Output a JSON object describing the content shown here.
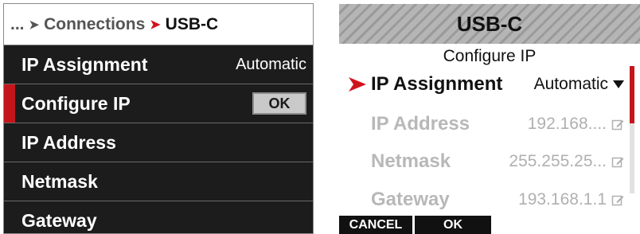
{
  "left_panel": {
    "breadcrumb": {
      "ellipsis": "...",
      "parent": "Connections",
      "current": "USB-C"
    },
    "rows": [
      {
        "label": "IP Assignment",
        "value": "Automatic"
      },
      {
        "label": "Configure IP",
        "button": "OK",
        "selected": true
      },
      {
        "label": "IP Address"
      },
      {
        "label": "Netmask"
      },
      {
        "label": "Gateway"
      }
    ]
  },
  "right_panel": {
    "title": "USB-C",
    "subtitle": "Configure IP",
    "rows": [
      {
        "label": "IP Assignment",
        "value": "Automatic",
        "icon": "chevron-down-icon",
        "state": "active"
      },
      {
        "label": "IP Address",
        "value": "192.168....",
        "icon": "edit-icon",
        "state": "disabled"
      },
      {
        "label": "Netmask",
        "value": "255.255.25...",
        "icon": "edit-icon",
        "state": "disabled"
      },
      {
        "label": "Gateway",
        "value": "193.168.1.1",
        "icon": "edit-icon",
        "state": "disabled"
      }
    ],
    "softkeys": {
      "cancel": "CANCEL",
      "ok": "OK"
    }
  },
  "colors": {
    "accent_red": "#c4151c",
    "dark_bg": "#1c1c1c",
    "disabled_text": "#b8b8b8"
  }
}
